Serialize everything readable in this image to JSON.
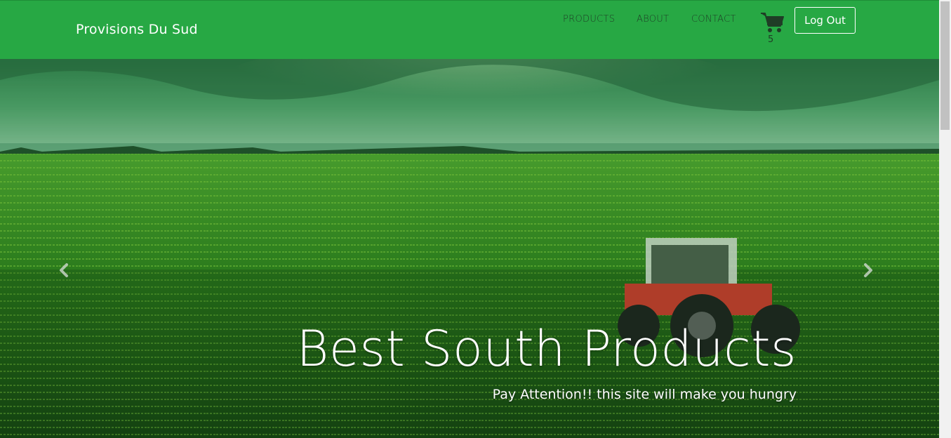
{
  "brand": "Provisions Du Sud",
  "nav": {
    "products": "PRODUCTS",
    "about": "ABOUT",
    "contact": "CONTACT"
  },
  "cart": {
    "icon": "shopping-cart-icon",
    "count": "5"
  },
  "auth": {
    "logout_label": "Log Out"
  },
  "hero": {
    "title": "Best South Products",
    "subtitle": "Pay Attention!! this site will make you hungry",
    "prev_icon": "chevron-left-icon",
    "next_icon": "chevron-right-icon"
  },
  "colors": {
    "navbar": "#27a844",
    "nav_text": "#1f3d26"
  }
}
